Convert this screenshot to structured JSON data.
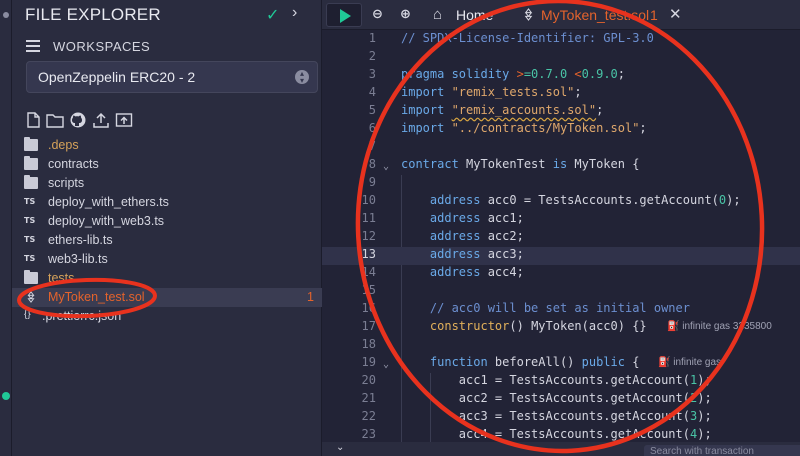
{
  "sidebar": {
    "title": "FILE EXPLORER",
    "workspaces_label": "WORKSPACES",
    "workspace_select": "OpenZeppelin ERC20 - 2",
    "tree": [
      {
        "type": "folder",
        "label": ".deps",
        "dim": true
      },
      {
        "type": "folder",
        "label": "contracts"
      },
      {
        "type": "folder",
        "label": "scripts"
      },
      {
        "type": "ts",
        "label": "deploy_with_ethers.ts"
      },
      {
        "type": "ts",
        "label": "deploy_with_web3.ts"
      },
      {
        "type": "ts",
        "label": "ethers-lib.ts"
      },
      {
        "type": "ts",
        "label": "web3-lib.ts"
      },
      {
        "type": "folder",
        "label": "tests",
        "dim": true
      },
      {
        "type": "sol",
        "label": "MyToken_test.sol",
        "active": true,
        "count": "1"
      },
      {
        "type": "json",
        "label": ".prettierrc.json"
      }
    ]
  },
  "tabs": {
    "home": "Home",
    "file": "MyToken_test.sol",
    "file_count": "1"
  },
  "code": {
    "lines": [
      {
        "n": "1",
        "t": "// SPDX-License-Identifier: GPL-3.0"
      },
      {
        "n": "2",
        "t": ""
      },
      {
        "n": "3",
        "t": "pragma solidity >=0.7.0 <0.9.0;"
      },
      {
        "n": "4",
        "t": "import \"remix_tests.sol\";"
      },
      {
        "n": "5",
        "t": "import \"remix_accounts.sol\";"
      },
      {
        "n": "6",
        "t": "import \"../contracts/MyToken.sol\";"
      },
      {
        "n": "7",
        "t": ""
      },
      {
        "n": "8",
        "t": "contract MyTokenTest is MyToken {"
      },
      {
        "n": "9",
        "t": ""
      },
      {
        "n": "10",
        "t": "    address acc0 = TestsAccounts.getAccount(0);"
      },
      {
        "n": "11",
        "t": "    address acc1;"
      },
      {
        "n": "12",
        "t": "    address acc2;"
      },
      {
        "n": "13",
        "t": "    address acc3;"
      },
      {
        "n": "14",
        "t": "    address acc4;"
      },
      {
        "n": "15",
        "t": ""
      },
      {
        "n": "16",
        "t": "    // acc0 will be set as initial owner"
      },
      {
        "n": "17",
        "t": "    constructor() MyToken(acc0) {}"
      },
      {
        "n": "18",
        "t": ""
      },
      {
        "n": "19",
        "t": "    function beforeAll() public {"
      },
      {
        "n": "20",
        "t": "        acc1 = TestsAccounts.getAccount(1);"
      },
      {
        "n": "21",
        "t": "        acc2 = TestsAccounts.getAccount(2);"
      },
      {
        "n": "22",
        "t": "        acc3 = TestsAccounts.getAccount(3);"
      },
      {
        "n": "23",
        "t": "        acc4 = TestsAccounts.getAccount(4);"
      }
    ],
    "gas_hint_17": "infinite gas 3235800",
    "gas_hint_19": "infinite gas"
  },
  "bottom": {
    "search_placeholder": "Search with transaction"
  },
  "colors": {
    "accent": "#e4632c",
    "success": "#20c997",
    "annotation": "#e8321e"
  }
}
